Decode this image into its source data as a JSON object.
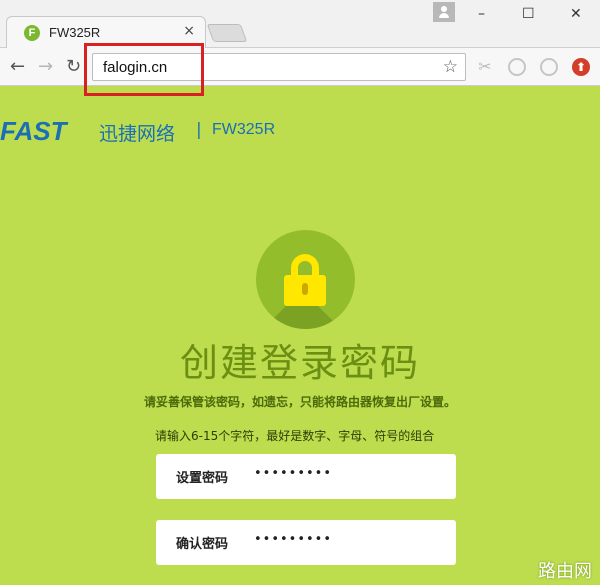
{
  "browser": {
    "tab": {
      "favicon_letter": "F",
      "title": "FW325R",
      "close_glyph": "×"
    },
    "window_controls": {
      "minimize": "–",
      "maximize": "☐",
      "close": "✕"
    },
    "nav": {
      "back": "←",
      "forward": "→",
      "reload": "↻"
    },
    "address_bar": {
      "value": "falogin.cn",
      "bookmark_glyph": "☆"
    },
    "extensions": {
      "ext1": "✂",
      "ext4": "⬆"
    }
  },
  "header": {
    "logo": "FAST",
    "brand_cn": "迅捷网络",
    "separator": "|",
    "model": "FW325R"
  },
  "main": {
    "title": "创建登录密码",
    "notice": "请妥善保管该密码，如遗忘，只能将路由器恢复出厂设置。",
    "hint": "请输入6-15个字符，最好是数字、字母、符号的组合",
    "fields": [
      {
        "label": "设置密码",
        "value": "•••••••••"
      },
      {
        "label": "确认密码",
        "value": "•••••••••"
      }
    ]
  },
  "watermark": "路由网",
  "colors": {
    "page_bg": "#bddc4e",
    "brand_blue": "#1a6fb5",
    "title_green": "#6a8f12",
    "lock_yellow": "#ffe700",
    "highlight_red": "#d92024"
  }
}
